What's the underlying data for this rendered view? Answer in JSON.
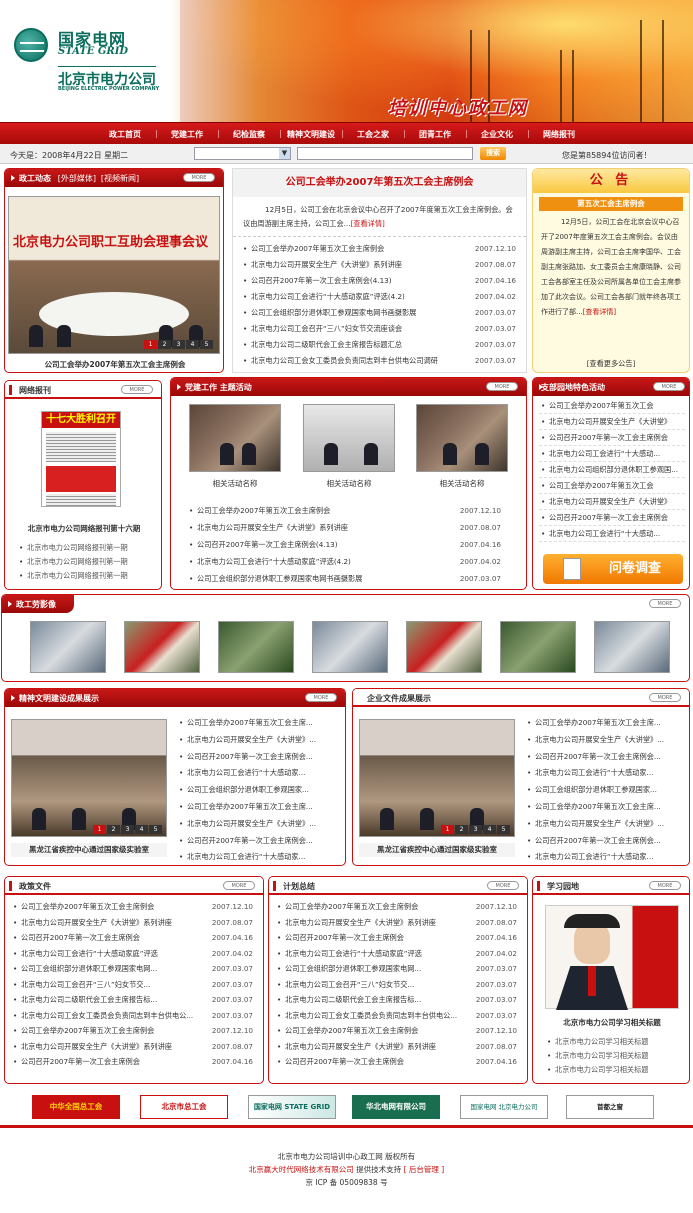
{
  "header": {
    "logo_cn": "国家电网",
    "logo_en": "STATE GRID",
    "company": "北京市电力公司",
    "company_en": "BEIJING ELECTRIC POWER COMPANY",
    "site_title": "培训中心政工网"
  },
  "nav": [
    "政工首页",
    "党建工作",
    "纪检监察",
    "精神文明建设",
    "工会之家",
    "团青工作",
    "企业文化",
    "网络报刊"
  ],
  "datebar": {
    "date": "今天是：2008年4月22日  星期二",
    "search_btn": "搜索",
    "visitor": "您是第85894位访问者！"
  },
  "zgdt": {
    "title": "政工动态",
    "tab1": "[外部媒体]",
    "tab2": "[视频新闻]",
    "more": "MORE",
    "photo_banner": "北京电力公司职工互助会理事会议",
    "caption": "公司工会举办2007年第五次工会主席例会",
    "pages": [
      "1",
      "2",
      "3",
      "4",
      "5"
    ]
  },
  "headline": {
    "title": "公司工会举办2007年第五次工会主席例会",
    "summary": "12月5日，公司工会在北京会议中心召开了2007年度第五次工会主席例会。会议由周游副主席主持，公司工会...",
    "detail": "[查看详情]",
    "items": [
      [
        "公司工会举办2007年第五次工会主席例会",
        "2007.12.10"
      ],
      [
        "北京电力公司开展安全生产《大讲堂》系列讲座",
        "2007.08.07"
      ],
      [
        "公司召开2007年第一次工会主席例会(4.13)",
        "2007.04.16"
      ],
      [
        "北京电力公司工会进行“十大感动家庭”评选(4.2)",
        "2007.04.02"
      ],
      [
        "公司工会组织部分退休职工参观国家电网书画摄影展",
        "2007.03.07"
      ],
      [
        "北京电力公司工会召开“三八”妇女节交流座谈会",
        "2007.03.07"
      ],
      [
        "北京电力公司二级职代会工会主席报告标题汇总",
        "2007.03.07"
      ],
      [
        "北京电力公司工会女工委员会负责同志到丰台供电公司调研",
        "2007.03.07"
      ]
    ]
  },
  "notice": {
    "title": "公  告",
    "subtitle": "第五次工会主席例会",
    "body": "12月5日，公司工会在北京会议中心召开了2007年度第五次工会主席例会。会议由周游副主席主持，公司工会主席李国华、工会副主席张路加、女工委员会主席康晓静、公司工会各部室主任及公司所属各单位工会主席参加了此次会议。公司工会各部门就年终各项工作进行了部...",
    "detail": "[查看详情]",
    "more": "[查看更多公告]"
  },
  "paper": {
    "title": "网络报刊",
    "more": "MORE",
    "cover_title": "十七大胜利召开",
    "caption": "北京市电力公司网络报刊第十六期",
    "items": [
      "北京市电力公司网络报刊第一期",
      "北京市电力公司网络报刊第一期",
      "北京市电力公司网络报刊第一期"
    ]
  },
  "party": {
    "title": "党建工作  主题活动",
    "more": "MORE",
    "photo_captions": [
      "相关活动名称",
      "相关活动名称",
      "相关活动名称"
    ],
    "items": [
      [
        "公司工会举办2007年第五次工会主席例会",
        "2007.12.10"
      ],
      [
        "北京电力公司开展安全生产《大讲堂》系列讲座",
        "2007.08.07"
      ],
      [
        "公司召开2007年第一次工会主席例会(4.13)",
        "2007.04.16"
      ],
      [
        "北京电力公司工会进行“十大感动家庭”评选(4.2)",
        "2007.04.02"
      ],
      [
        "公司工会组织部分退休职工参观国家电网书画摄影展",
        "2007.03.07"
      ]
    ]
  },
  "branch": {
    "title": "支部园地特色活动",
    "more": "MORE",
    "items": [
      "公司工会举办2007年第五次工会",
      "北京电力公司开展安全生产《大讲堂》",
      "公司召开2007年第一次工会主席例会",
      "北京电力公司工会进行“十大感动...",
      "北京电力公司组织部分退休职工参观国...",
      "公司工会举办2007年第五次工会",
      "北京电力公司开展安全生产《大讲堂》",
      "公司召开2007年第一次工会主席例会",
      "北京电力公司工会进行“十大感动..."
    ],
    "survey": "问卷调查"
  },
  "style": {
    "title": "政工劳影像",
    "more": "MORE"
  },
  "civil": {
    "title": "精神文明建设成果展示",
    "more": "MORE",
    "caption": "黑龙江省疾控中心通过国家级实验室",
    "pages": [
      "1",
      "2",
      "3",
      "4",
      "5"
    ],
    "items": [
      "公司工会举办2007年第五次工会主席...",
      "北京电力公司开展安全生产《大讲堂》...",
      "公司召开2007年第一次工会主席例会...",
      "北京电力公司工会进行“十大感动家...",
      "公司工会组织部分退休职工参观国家...",
      "公司工会举办2007年第五次工会主席...",
      "北京电力公司开展安全生产《大讲堂》...",
      "公司召开2007年第一次工会主席例会...",
      "北京电力公司工会进行“十大感动家..."
    ]
  },
  "corp": {
    "title": "企业文件成果展示",
    "more": "MORE",
    "caption": "黑龙江省疾控中心通过国家级实验室",
    "pages": [
      "1",
      "2",
      "3",
      "4",
      "5"
    ],
    "items": [
      "公司工会举办2007年第五次工会主席...",
      "北京电力公司开展安全生产《大讲堂》...",
      "公司召开2007年第一次工会主席例会...",
      "北京电力公司工会进行“十大感动家...",
      "公司工会组织部分退休职工参观国家...",
      "公司工会举办2007年第五次工会主席...",
      "北京电力公司开展安全生产《大讲堂》...",
      "公司召开2007年第一次工会主席例会...",
      "北京电力公司工会进行“十大感动家..."
    ]
  },
  "policy": {
    "title": "政策文件",
    "more": "MORE",
    "items": [
      [
        "公司工会举办2007年第五次工会主席例会",
        "2007.12.10"
      ],
      [
        "北京电力公司开展安全生产《大讲堂》系列讲座",
        "2007.08.07"
      ],
      [
        "公司召开2007年第一次工会主席例会",
        "2007.04.16"
      ],
      [
        "北京电力公司工会进行“十大感动家庭”评选",
        "2007.04.02"
      ],
      [
        "公司工会组织部分退休职工参观国家电网...",
        "2007.03.07"
      ],
      [
        "北京电力公司工会召开“三八”妇女节交...",
        "2007.03.07"
      ],
      [
        "北京电力公司二级职代会工会主席报告标...",
        "2007.03.07"
      ],
      [
        "北京电力公司工会女工委员会负责同志到丰台供电公...",
        "2007.03.07"
      ],
      [
        "公司工会举办2007年第五次工会主席例会",
        "2007.12.10"
      ],
      [
        "北京电力公司开展安全生产《大讲堂》系列讲座",
        "2007.08.07"
      ],
      [
        "公司召开2007年第一次工会主席例会",
        "2007.04.16"
      ]
    ]
  },
  "plan": {
    "title": "计划总结",
    "more": "MORE",
    "items": [
      [
        "公司工会举办2007年第五次工会主席例会",
        "2007.12.10"
      ],
      [
        "北京电力公司开展安全生产《大讲堂》系列讲座",
        "2007.08.07"
      ],
      [
        "公司召开2007年第一次工会主席例会",
        "2007.04.16"
      ],
      [
        "北京电力公司工会进行“十大感动家庭”评选",
        "2007.04.02"
      ],
      [
        "公司工会组织部分退休职工参观国家电网...",
        "2007.03.07"
      ],
      [
        "北京电力公司工会召开“三八”妇女节交...",
        "2007.03.07"
      ],
      [
        "北京电力公司二级职代会工会主席报告标...",
        "2007.03.07"
      ],
      [
        "北京电力公司工会女工委员会负责同志到丰台供电公...",
        "2007.03.07"
      ],
      [
        "公司工会举办2007年第五次工会主席例会",
        "2007.12.10"
      ],
      [
        "北京电力公司开展安全生产《大讲堂》系列讲座",
        "2007.08.07"
      ],
      [
        "公司召开2007年第一次工会主席例会",
        "2007.04.16"
      ]
    ]
  },
  "study": {
    "title": "学习园地",
    "more": "MORE",
    "caption": "北京市电力公司学习相关标题",
    "items": [
      "北京市电力公司学习相关标题",
      "北京市电力公司学习相关标题",
      "北京市电力公司学习相关标题"
    ]
  },
  "links": [
    "中华全国总工会",
    "北京市总工会",
    "国家电网 STATE GRID",
    "华北电网有限公司",
    "国家电网 北京电力公司",
    "首都之窗 www.beijing.gov.cn"
  ],
  "footer": {
    "line1": "北京市电力公司培训中心政工网 版权所有",
    "company": "北京赢大时代网络技术有限公司",
    "support": " 提供技术支持 ",
    "admin": "[ 后台管理 ]",
    "icp": "京 ICP 备 05009838 号"
  },
  "colors": {
    "primary": "#c81010",
    "brand": "#0a6e5e"
  }
}
